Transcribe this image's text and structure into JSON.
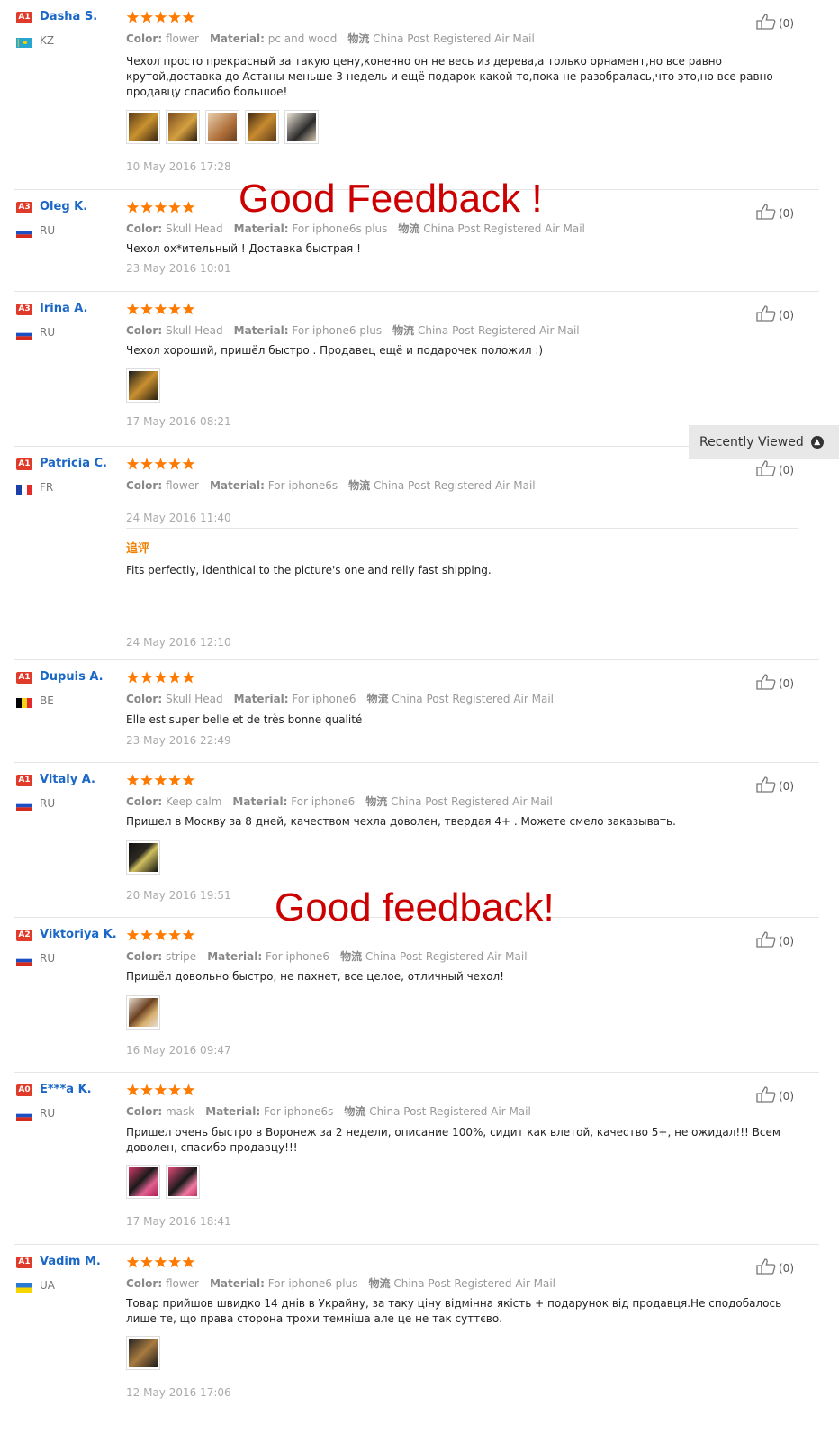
{
  "overlays": {
    "good_feedback_1": "Good Feedback !",
    "good_feedback_2": "Good feedback!"
  },
  "recently_viewed": "Recently Viewed",
  "labels": {
    "color": "Color:",
    "material": "Material:",
    "shipping": "物流",
    "additional": "追评"
  },
  "reviews": [
    {
      "level": "A1",
      "name": "Dasha S.",
      "country": "KZ",
      "color": "flower",
      "material": "pc and wood",
      "shipping": "China Post Registered Air Mail",
      "text": "Чехол просто прекрасный за такую цену,конечно он не весь из дерева,а только орнамент,но все равно крутой,доставка до Астаны меньше 3 недель и ещё подарок какой то,пока не разобралась,что это,но все равно продавцу спасибо большое!",
      "date": "10 May 2016 17:28",
      "likes": "(0)"
    },
    {
      "level": "A3",
      "name": "Oleg K.",
      "country": "RU",
      "color": "Skull Head",
      "material": "For iphone6s plus",
      "shipping": "China Post Registered Air Mail",
      "text": "Чехол ох*ительный ! Доставка быстрая !",
      "date": "23 May 2016 10:01",
      "likes": "(0)"
    },
    {
      "level": "A3",
      "name": "Irina A.",
      "country": "RU",
      "color": "Skull Head",
      "material": "For iphone6 plus",
      "shipping": "China Post Registered Air Mail",
      "text": "Чехол хороший, пришёл быстро . Продавец ещё и подарочек положил :)",
      "date": "17 May 2016 08:21",
      "likes": "(0)"
    },
    {
      "level": "A1",
      "name": "Patricia C.",
      "country": "FR",
      "color": "flower",
      "material": "For iphone6s",
      "shipping": "China Post Registered Air Mail",
      "text": "",
      "date": "24 May 2016 11:40",
      "additional_text": "Fits perfectly, identhical to the picture's one and relly fast shipping.",
      "additional_date": "24 May 2016 12:10",
      "likes": "(0)"
    },
    {
      "level": "A1",
      "name": "Dupuis A.",
      "country": "BE",
      "color": "Skull Head",
      "material": "For iphone6",
      "shipping": "China Post Registered Air Mail",
      "text": "Elle est super belle et de très bonne qualité",
      "date": "23 May 2016 22:49",
      "likes": "(0)"
    },
    {
      "level": "A1",
      "name": "Vitaly A.",
      "country": "RU",
      "color": "Keep calm",
      "material": "For iphone6",
      "shipping": "China Post Registered Air Mail",
      "text": "Пришел в Москву за 8 дней, качеством чехла доволен, твердая 4+ . Можете смело заказывать.",
      "date": "20 May 2016 19:51",
      "likes": "(0)"
    },
    {
      "level": "A2",
      "name": "Viktoriya K.",
      "country": "RU",
      "color": "stripe",
      "material": "For iphone6",
      "shipping": "China Post Registered Air Mail",
      "text": "Пришёл довольно быстро, не пахнет, все целое, отличный чехол!",
      "date": "16 May 2016 09:47",
      "likes": "(0)"
    },
    {
      "level": "A0",
      "name": "E***a K.",
      "country": "RU",
      "color": "mask",
      "material": "For iphone6s",
      "shipping": "China Post Registered Air Mail",
      "text": "Пришел очень быстро в Воронеж за 2 недели, описание 100%, сидит как влетой, качество 5+, не ожидал!!! Всем доволен, спасибо продавцу!!!",
      "date": "17 May 2016 18:41",
      "likes": "(0)"
    },
    {
      "level": "A1",
      "name": "Vadim M.",
      "country": "UA",
      "color": "flower",
      "material": "For iphone6 plus",
      "shipping": "China Post Registered Air Mail",
      "text": "Товар прийшов швидко 14 днів в Украйну, за таку ціну відмінна якість + подарунок від продавця.Не сподобалось лише те, що права сторона трохи темніша але це не так суттєво.",
      "date": "12 May 2016 17:06",
      "likes": "(0)"
    }
  ]
}
